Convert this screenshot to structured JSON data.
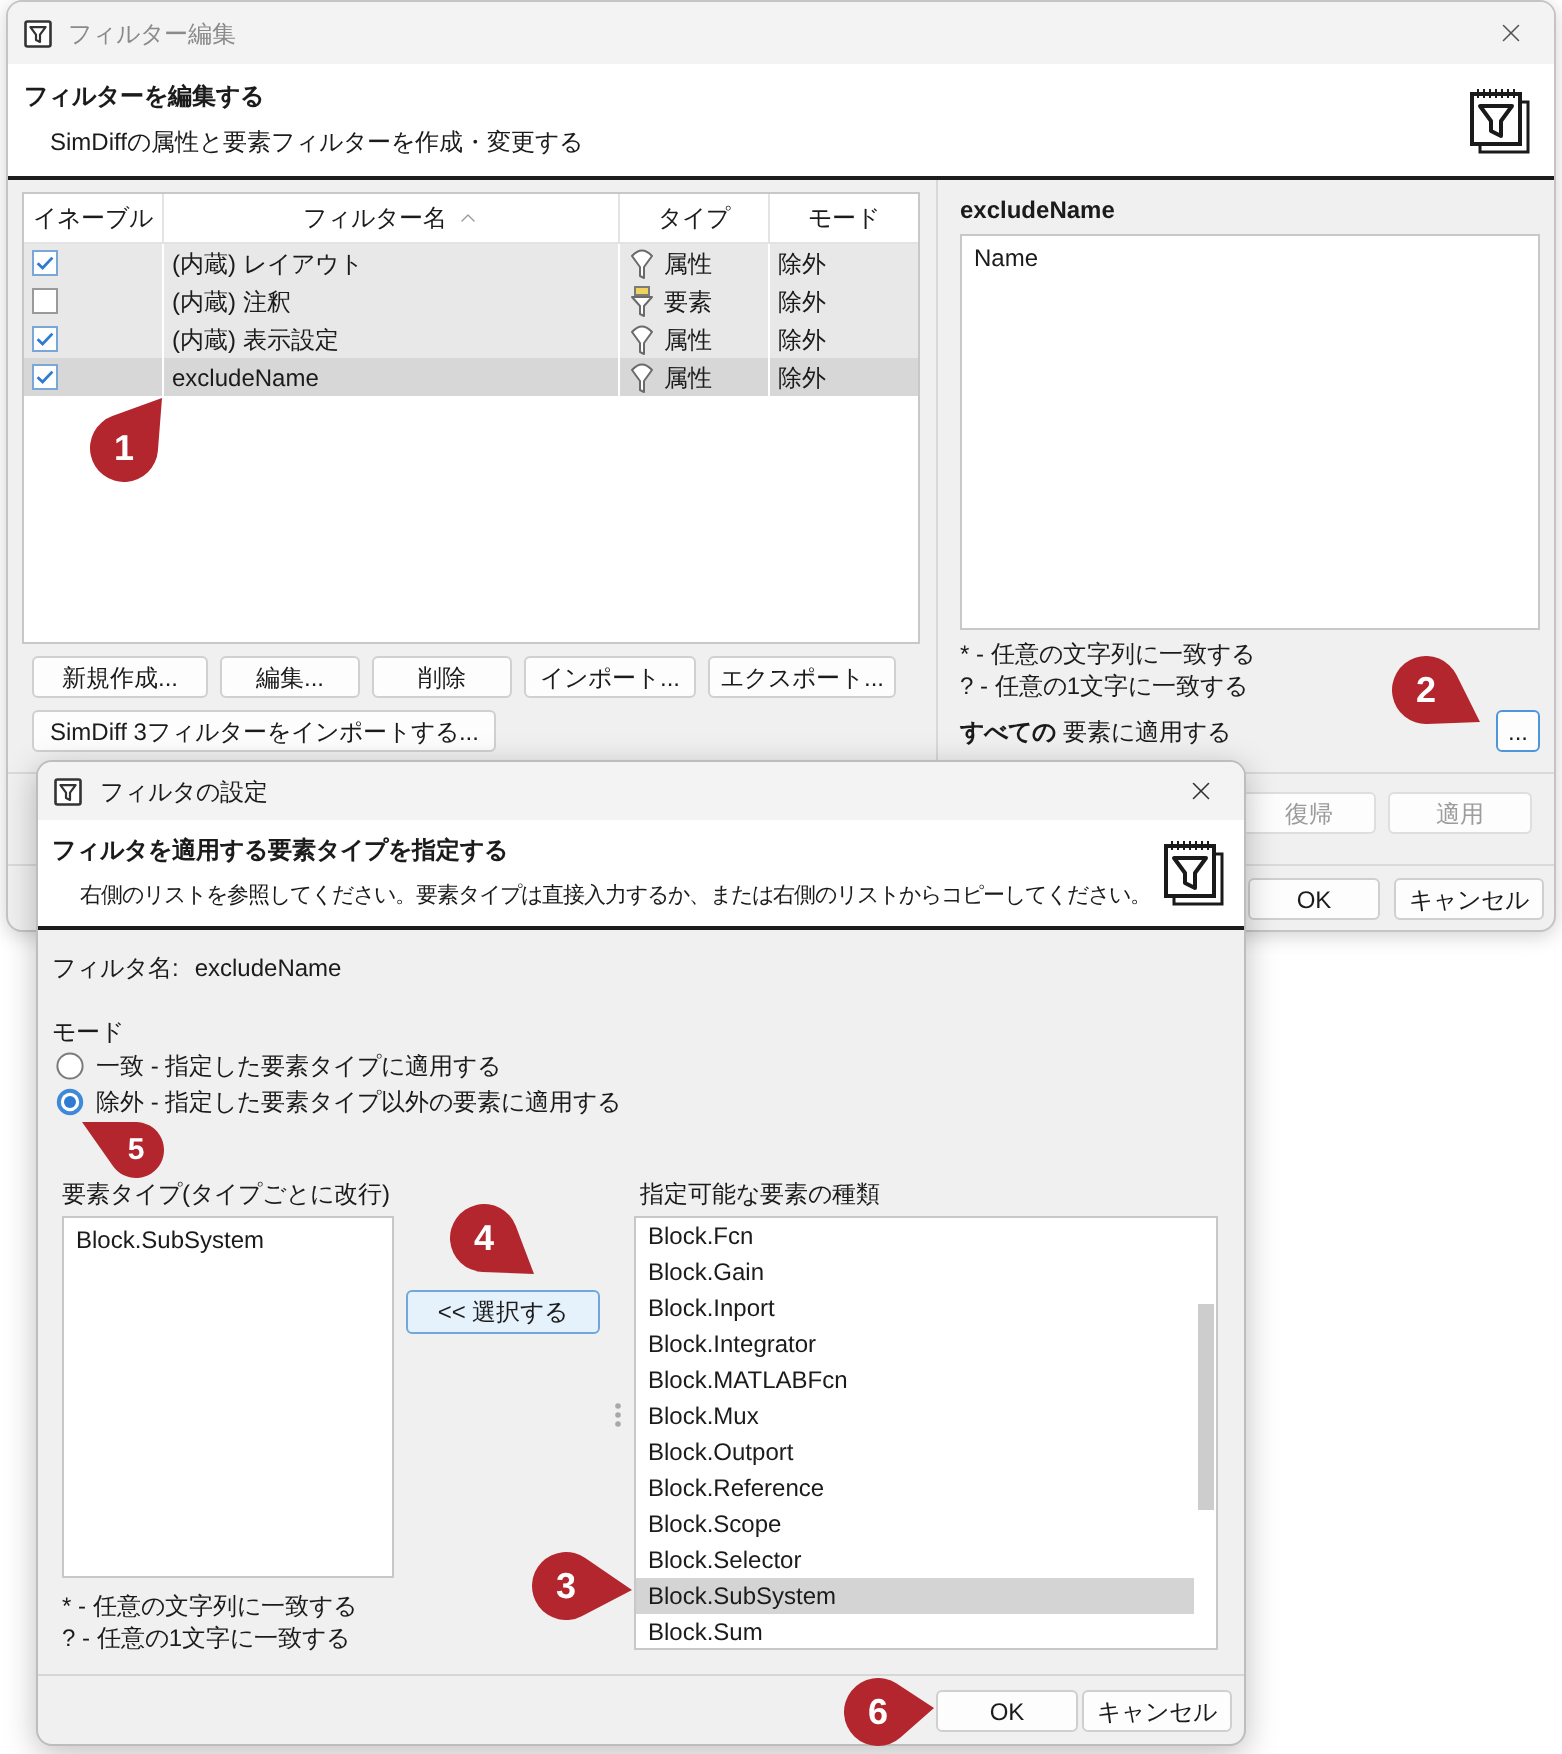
{
  "filter_editor": {
    "title": "フィルター編集",
    "header": {
      "heading": "フィルターを編集する",
      "description": "SimDiffの属性と要素フィルターを作成・変更する"
    },
    "table": {
      "columns": [
        {
          "label": "イネーブル",
          "sorted": false
        },
        {
          "label": "フィルター名",
          "sorted": true
        },
        {
          "label": "タイプ",
          "sorted": false
        },
        {
          "label": "モード",
          "sorted": false
        }
      ],
      "rows": [
        {
          "enabled": true,
          "name": "(内蔵) レイアウト",
          "kind": "attribute",
          "type": "属性",
          "mode": "除外",
          "selected": false
        },
        {
          "enabled": false,
          "name": "(内蔵) 注釈",
          "kind": "element",
          "type": "要素",
          "mode": "除外",
          "selected": false
        },
        {
          "enabled": true,
          "name": "(内蔵) 表示設定",
          "kind": "attribute",
          "type": "属性",
          "mode": "除外",
          "selected": false
        },
        {
          "enabled": true,
          "name": "excludeName",
          "kind": "attribute",
          "type": "属性",
          "mode": "除外",
          "selected": true
        }
      ]
    },
    "list_buttons": [
      "新規作成...",
      "編集...",
      "削除",
      "インポート...",
      "エクスポート..."
    ],
    "import_button": "SimDiff 3フィルターをインポートする...",
    "detail": {
      "title": "excludeName",
      "value": "Name",
      "hints": [
        "* - 任意の文字列に一致する",
        "? - 任意の1文字に一致する"
      ],
      "scope": "**すべての** 要素に適用する",
      "browse_button": {
        "label": "...",
        "focused": true
      }
    },
    "action_buttons": [
      {
        "label": "復帰",
        "disabled": true
      },
      {
        "label": "適用",
        "disabled": true
      }
    ],
    "dialog_buttons": [
      "OK",
      "キャンセル"
    ]
  },
  "filter_settings": {
    "title": "フィルタの設定",
    "header": {
      "heading": "フィルタを適用する要素タイプを指定する",
      "description": "右側のリストを参照してください。要素タイプは直接入力するか、または右側のリストからコピーしてください。"
    },
    "name_label": "フィルタ名:",
    "name": "excludeName",
    "mode": {
      "label": "モード",
      "options": [
        {
          "label": "一致 - 指定した要素タイプに適用する",
          "selected": false
        },
        {
          "label": "除外 - 指定した要素タイプ以外の要素に適用する",
          "selected": true
        }
      ]
    },
    "element_types": {
      "label": "要素タイプ(タイプごとに改行)",
      "value": "Block.SubSystem",
      "hints": [
        "* - 任意の文字列に一致する",
        "? - 任意の1文字に一致する"
      ]
    },
    "select_button": {
      "label": "<< 選択する",
      "focused": true
    },
    "available_types": {
      "label": "指定可能な要素の種類",
      "items": [
        {
          "label": "Block.Fcn",
          "selected": false
        },
        {
          "label": "Block.Gain",
          "selected": false
        },
        {
          "label": "Block.Inport",
          "selected": false
        },
        {
          "label": "Block.Integrator",
          "selected": false
        },
        {
          "label": "Block.MATLABFcn",
          "selected": false
        },
        {
          "label": "Block.Mux",
          "selected": false
        },
        {
          "label": "Block.Outport",
          "selected": false
        },
        {
          "label": "Block.Reference",
          "selected": false
        },
        {
          "label": "Block.Scope",
          "selected": false
        },
        {
          "label": "Block.Selector",
          "selected": false
        },
        {
          "label": "Block.SubSystem",
          "selected": true
        },
        {
          "label": "Block.Sum",
          "selected": false
        }
      ]
    },
    "buttons": [
      "OK",
      "キャンセル"
    ]
  },
  "callouts": [
    "1",
    "2",
    "3",
    "4",
    "5",
    "6"
  ]
}
